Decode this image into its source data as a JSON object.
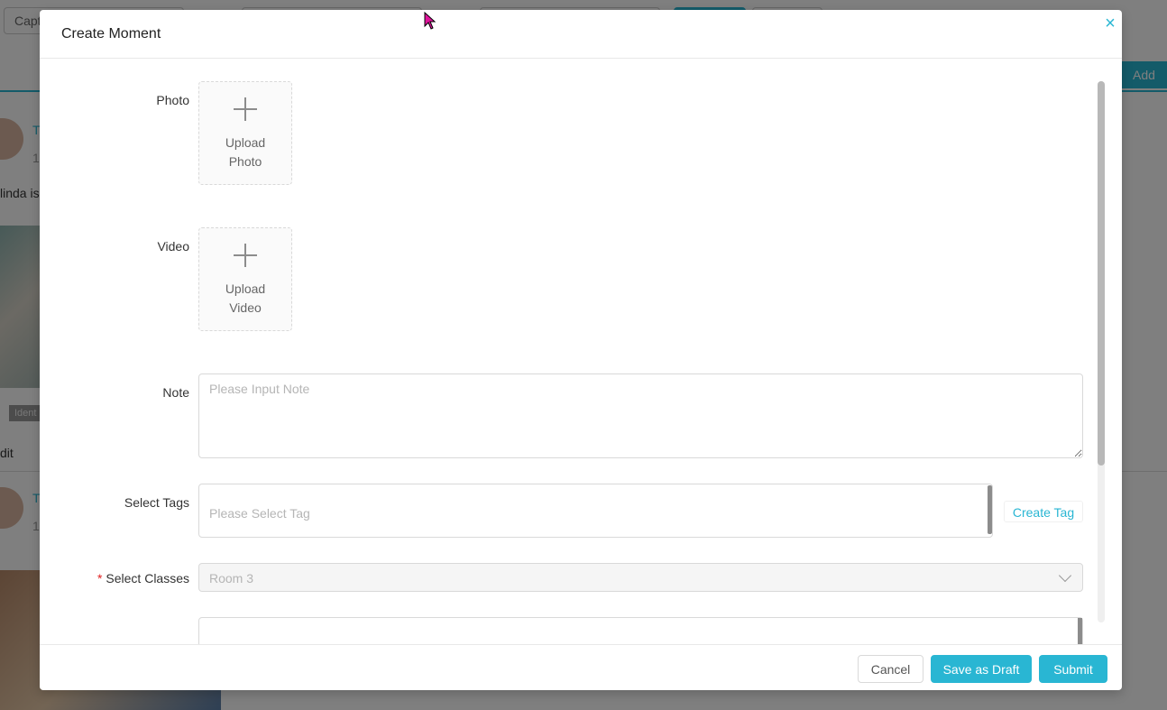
{
  "background": {
    "search_prefix": "Capt",
    "add_label": "Add",
    "post_text": "linda is",
    "tag_text": "Ident",
    "action_text": "dit",
    "name_initial_1": "T",
    "name_initial_2": "T",
    "date_fragment_1": "1.",
    "date_fragment_2": "1."
  },
  "modal": {
    "title": "Create Moment",
    "close_symbol": "×",
    "fields": {
      "photo_label": "Photo",
      "photo_upload_text": "Upload\nPhoto",
      "video_label": "Video",
      "video_upload_text": "Upload\nVideo",
      "note_label": "Note",
      "note_placeholder": "Please Input Note",
      "tags_label": "Select Tags",
      "tags_placeholder": "Please Select Tag",
      "create_tag_label": "Create Tag",
      "classes_label": "Select Classes",
      "classes_required_mark": "*",
      "classes_value": "Room 3"
    },
    "footer": {
      "cancel_label": "Cancel",
      "draft_label": "Save as Draft",
      "submit_label": "Submit"
    }
  },
  "colors": {
    "accent": "#29b6d3",
    "required": "#e02020",
    "cursor": "#e0149c"
  }
}
